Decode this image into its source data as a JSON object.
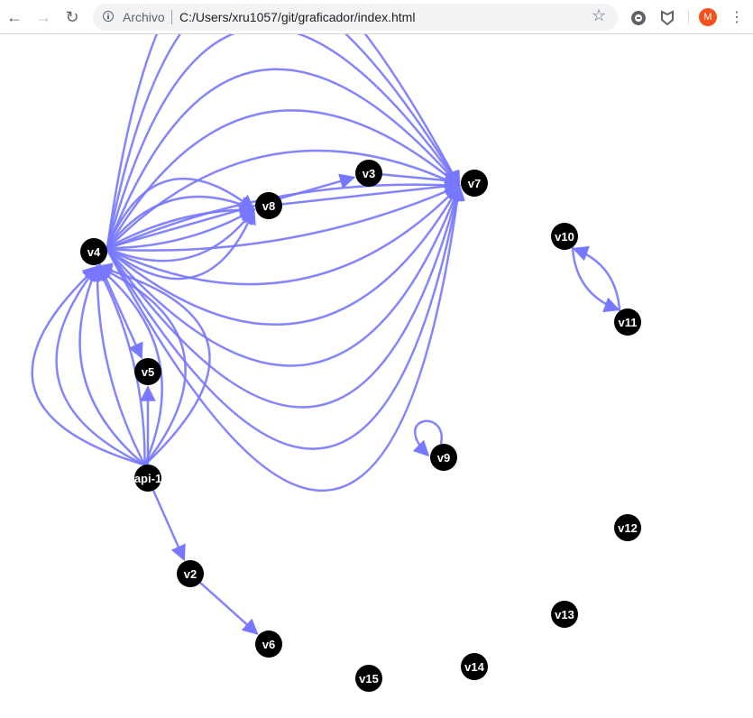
{
  "browser": {
    "origin_label": "Archivo",
    "url": "C:/Users/xru1057/git/graficador/index.html",
    "avatar_initial": "M",
    "accent_color": "#f4511e",
    "icons": [
      "back-icon",
      "forward-icon",
      "reload-icon",
      "info-icon",
      "star-icon",
      "extension-icon",
      "shield-icon",
      "menu-icon"
    ]
  },
  "graph": {
    "edge_color": "#7777ff",
    "node_color": "#000000",
    "nodes": [
      {
        "id": "v4",
        "label": "v4"
      },
      {
        "id": "v7",
        "label": "v7"
      },
      {
        "id": "v8",
        "label": "v8"
      },
      {
        "id": "v3",
        "label": "v3"
      },
      {
        "id": "v5",
        "label": "v5"
      },
      {
        "id": "api1",
        "label": "api-1"
      },
      {
        "id": "v2",
        "label": "v2"
      },
      {
        "id": "v6",
        "label": "v6"
      },
      {
        "id": "v9",
        "label": "v9"
      },
      {
        "id": "v10",
        "label": "v10"
      },
      {
        "id": "v11",
        "label": "v11"
      },
      {
        "id": "v12",
        "label": "v12"
      },
      {
        "id": "v13",
        "label": "v13"
      },
      {
        "id": "v14",
        "label": "v14"
      },
      {
        "id": "v15",
        "label": "v15"
      }
    ],
    "edges": [
      {
        "source": "v4",
        "target": "v7",
        "count": 14
      },
      {
        "source": "v4",
        "target": "v8",
        "count": 6
      },
      {
        "source": "v4",
        "target": "v3",
        "count": 1
      },
      {
        "source": "v8",
        "target": "v7",
        "count": 1
      },
      {
        "source": "v3",
        "target": "v7",
        "count": 1
      },
      {
        "source": "api1",
        "target": "v4",
        "count": 8
      },
      {
        "source": "v4",
        "target": "v5",
        "count": 1
      },
      {
        "source": "api1",
        "target": "v5",
        "count": 1
      },
      {
        "source": "api1",
        "target": "v2",
        "count": 1
      },
      {
        "source": "v2",
        "target": "v6",
        "count": 1
      },
      {
        "source": "v9",
        "target": "v9",
        "count": 1
      },
      {
        "source": "v10",
        "target": "v11",
        "count": 1
      },
      {
        "source": "v11",
        "target": "v10",
        "count": 1
      }
    ]
  }
}
